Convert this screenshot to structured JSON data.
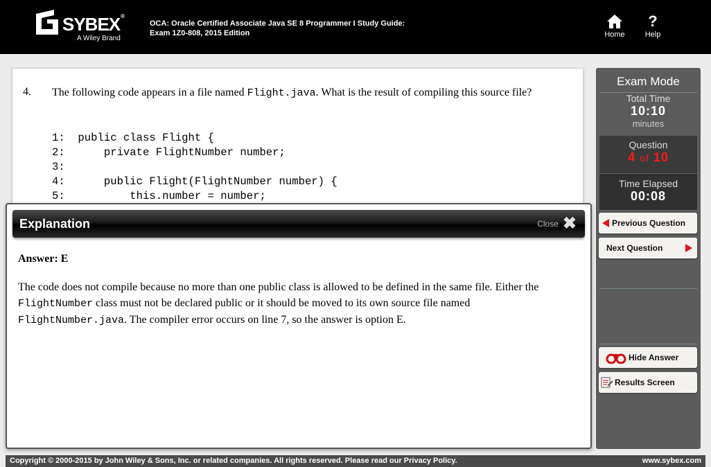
{
  "header": {
    "logo_text": "SYBEX",
    "logo_brand": "A Wiley Brand",
    "book_title_line1": "OCA: Oracle Certified Associate Java SE 8 Programmer I Study Guide:",
    "book_title_line2": "Exam 1Z0-808, 2015 Edition",
    "home_label": "Home",
    "help_label": "Help",
    "help_glyph": "?"
  },
  "question": {
    "number": "4.",
    "text_before": "The following code appears in a file named ",
    "filename": "Flight.java",
    "text_after": ". What is the result of compiling this source file?",
    "code_lines": [
      "1:  public class Flight {",
      "2:      private FlightNumber number;",
      "3:",
      "4:      public Flight(FlightNumber number) {",
      "5:          this.number = number;"
    ]
  },
  "explanation": {
    "title": "Explanation",
    "close_label": "Close",
    "close_glyph": "✖",
    "answer": "Answer: E",
    "p1": "The code does not compile because no more than one public class is allowed to be defined in the same file. Either the ",
    "p1_code": "FlightNumber",
    "p2": " class must not be declared public or it should be moved to its own source file named ",
    "p2_code": "FlightNumber.java",
    "p3": ". The compiler error occurs on line 7, so the answer is option E."
  },
  "side": {
    "mode_title": "Exam Mode",
    "total_time_label": "Total Time",
    "total_time_value": "10:10",
    "total_time_unit": "minutes",
    "question_label": "Question",
    "question_current": "4",
    "question_of": "of",
    "question_total": "10",
    "elapsed_label": "Time Elapsed",
    "elapsed_value": "00:08",
    "prev_label": "Previous Question",
    "next_label": "Next Question",
    "hide_answer_label": "Hide Answer",
    "results_label": "Results Screen"
  },
  "footer": {
    "copyright": "Copyright © 2000-2015 by John Wiley & Sons, Inc. or related companies. All rights reserved. Please read our Privacy Policy.",
    "site": "www.sybex.com"
  },
  "colors": {
    "accent_red": "#ff1a1a",
    "arrow_red": "#e0141e",
    "panel_gray": "#5c5c5c"
  },
  "icons": [
    "home-icon",
    "help-icon",
    "close-icon",
    "left-arrow-icon",
    "right-arrow-icon",
    "binoculars-icon",
    "results-icon"
  ]
}
